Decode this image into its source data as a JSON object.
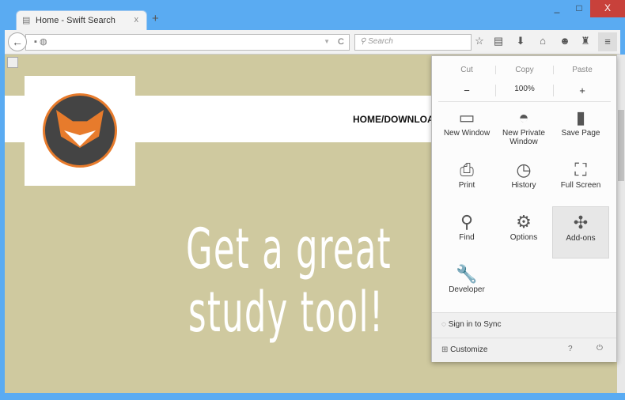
{
  "window": {
    "minimize": "_",
    "maximize": "□",
    "close": "X"
  },
  "tab": {
    "title": "Home - Swift Search",
    "close": "x",
    "new_tab": "+"
  },
  "nav": {
    "back": "←",
    "search_placeholder": "Search",
    "reload": "C",
    "dropdown": "▼"
  },
  "page": {
    "nav_text": "HOME/DOWNLOA",
    "headline_line1": "Get a great",
    "headline_line2": "study tool!"
  },
  "menu": {
    "edit": [
      "Cut",
      "Copy",
      "Paste"
    ],
    "zoom": {
      "minus": "−",
      "level": "100%",
      "plus": "+"
    },
    "items": [
      {
        "label": "New Window",
        "icon": "window-icon",
        "glyph": "▭"
      },
      {
        "label": "New Private Window",
        "icon": "mask-icon",
        "glyph": "◓"
      },
      {
        "label": "Save Page",
        "icon": "page-icon",
        "glyph": "▮"
      },
      {
        "label": "Print",
        "icon": "printer-icon",
        "glyph": "⎙"
      },
      {
        "label": "History",
        "icon": "clock-icon",
        "glyph": "◷"
      },
      {
        "label": "Full Screen",
        "icon": "fullscreen-icon",
        "glyph": "⛶"
      },
      {
        "label": "Find",
        "icon": "magnifier-icon",
        "glyph": "⚲"
      },
      {
        "label": "Options",
        "icon": "gear-icon",
        "glyph": "⚙"
      },
      {
        "label": "Add-ons",
        "icon": "puzzle-icon",
        "glyph": "✣",
        "selected": true
      },
      {
        "label": "Developer",
        "icon": "wrench-icon",
        "glyph": "🔧"
      }
    ],
    "sync": "Sign in to Sync",
    "customize": "Customize",
    "help": "?",
    "quit": "⏻"
  }
}
